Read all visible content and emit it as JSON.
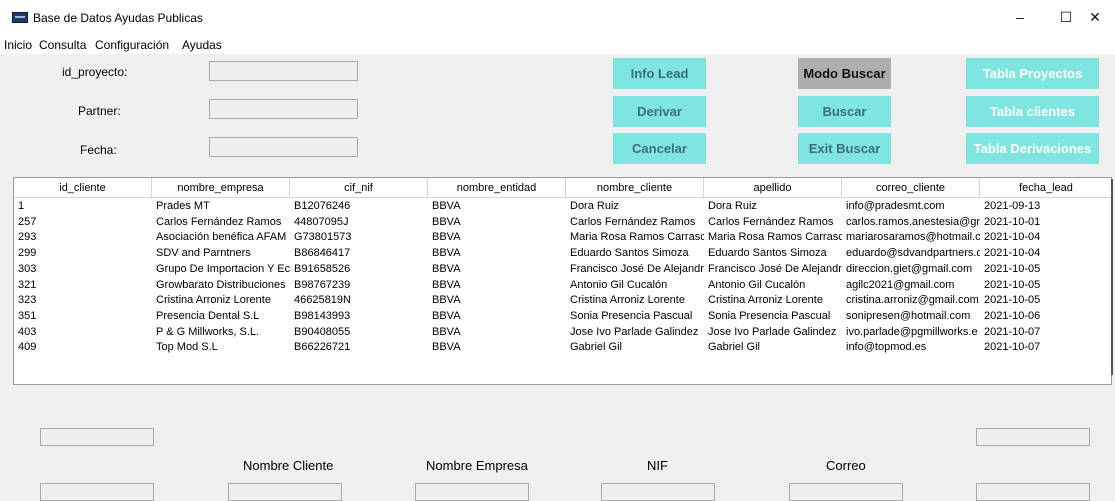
{
  "window": {
    "title": "Base de Datos Ayudas Publicas",
    "minimize": "–",
    "maximize": "☐",
    "close": "✕"
  },
  "menu": [
    "Inicio",
    "Consulta",
    "Configuración",
    "Ayudas"
  ],
  "form": {
    "id_proyecto_label": "id_proyecto:",
    "partner_label": "Partner:",
    "fecha_label": "Fecha:",
    "id_proyecto_value": "",
    "partner_value": "",
    "fecha_value": ""
  },
  "buttons": {
    "info_lead": "Info Lead",
    "derivar": "Derivar",
    "cancelar": "Cancelar",
    "modo_buscar": "Modo Buscar",
    "buscar": "Buscar",
    "exit_buscar": "Exit Buscar",
    "tabla_proyectos": "Tabla Proyectos",
    "tabla_clientes": "Tabla clientes",
    "tabla_derivaciones": "Tabla Derivaciones"
  },
  "colors": {
    "button_bg": "#7fe5e1",
    "button_text": "#ffffff",
    "button_text_dark": "#3c6f76",
    "mode_button_bg": "#aeaeae"
  },
  "table": {
    "columns": [
      "id_cliente",
      "nombre_empresa",
      "cif_nif",
      "nombre_entidad",
      "nombre_cliente",
      "apellido",
      "correo_cliente",
      "fecha_lead"
    ],
    "rows": [
      [
        "1",
        "Prades MT",
        "B12076246",
        "BBVA",
        "Dora Ruiz",
        "Dora Ruiz",
        "info@pradesmt.com",
        "2021-09-13"
      ],
      [
        "257",
        "Carlos Fernández Ramos",
        "44807095J",
        "BBVA",
        "Carlos Fernández Ramos",
        "Carlos Fernández Ramos",
        "carlos.ramos.anestesia@gn",
        "2021-10-01"
      ],
      [
        "293",
        "Asociación benéfica AFAM",
        "G73801573",
        "BBVA",
        "Maria Rosa Ramos Carrasco",
        "Maria Rosa Ramos Carrasco",
        "mariarosaramos@hotmail.c",
        "2021-10-04"
      ],
      [
        "299",
        "SDV and Parntners",
        "B86846417",
        "BBVA",
        "Eduardo Santos Simoza",
        "Eduardo Santos Simoza",
        "eduardo@sdvandpartners.c",
        "2021-10-04"
      ],
      [
        "303",
        "Grupo De Importacion Y Ec",
        "B91658526",
        "BBVA",
        "Francisco José De Alejandro",
        "Francisco José De Alejandro",
        "direccion.giet@gmail.com",
        "2021-10-05"
      ],
      [
        "321",
        "Growbarato Distribuciones",
        "B98767239",
        "BBVA",
        "Antonio Gil Cucalón",
        "Antonio Gil Cucalón",
        "agilc2021@gmail.com",
        "2021-10-05"
      ],
      [
        "323",
        "Cristina Arroniz Lorente",
        "46625819N",
        "BBVA",
        "Cristina Arroniz Lorente",
        "Cristina Arroniz Lorente",
        "cristina.arroniz@gmail.com",
        "2021-10-05"
      ],
      [
        "351",
        "Presencia Dental S.L",
        "B98143993",
        "BBVA",
        "Sonia Presencia Pascual",
        "Sonia Presencia Pascual",
        "sonipresen@hotmail.com",
        "2021-10-06"
      ],
      [
        "403",
        "P & G Millworks, S.L.",
        "B90408055",
        "BBVA",
        "Jose Ivo Parlade Galindez",
        "Jose Ivo Parlade Galindez",
        "ivo.parlade@pgmillworks.e",
        "2021-10-07"
      ],
      [
        "409",
        "Top Mod S.L",
        "B66226721",
        "BBVA",
        "Gabriel Gil",
        "Gabriel Gil",
        "info@topmod.es",
        "2021-10-07"
      ]
    ]
  },
  "bottom_labels": {
    "nombre_cliente": "Nombre Cliente",
    "nombre_empresa": "Nombre Empresa",
    "nif": "NIF",
    "correo": "Correo"
  }
}
